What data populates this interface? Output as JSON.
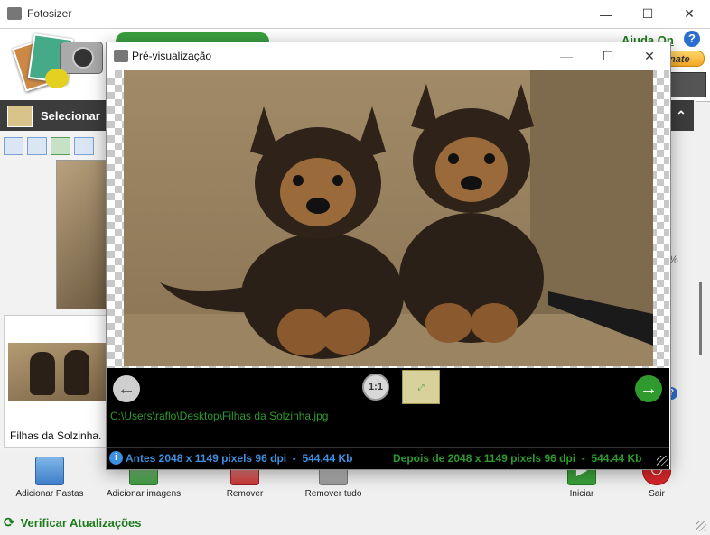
{
  "app": {
    "title": "Fotosizer",
    "help_label": "Ajuda On",
    "donate_label": "nate"
  },
  "left_panel": {
    "header": "Selecionar",
    "thumbnail_caption": "Filhas da Solzinha."
  },
  "toolbar": {
    "add_folders": "Adicionar Pastas",
    "add_images": "Adicionar imagens",
    "remove": "Remover",
    "remove_all": "Remover tudo",
    "start": "Iniciar",
    "exit": "Sair"
  },
  "update_link": "Verificar Atualizações",
  "preview": {
    "title": "Pré-visualização",
    "file_path": "C:\\Users\\raflo\\Desktop\\Filhas da Solzinha.jpg",
    "before": "Antes 2048 x 1149 pixels 96 dpi  -  544.44 Kb",
    "after": "Depois de 2048 x 1149 pixels 96 dpi  -  544.44 Kb",
    "zoom_label": "1:1"
  },
  "right_edge": {
    "percent_fragment": "%"
  },
  "colors": {
    "accent_green": "#1c7c1c",
    "status_blue": "#3d8fe0",
    "status_green": "#2e9a2e"
  }
}
